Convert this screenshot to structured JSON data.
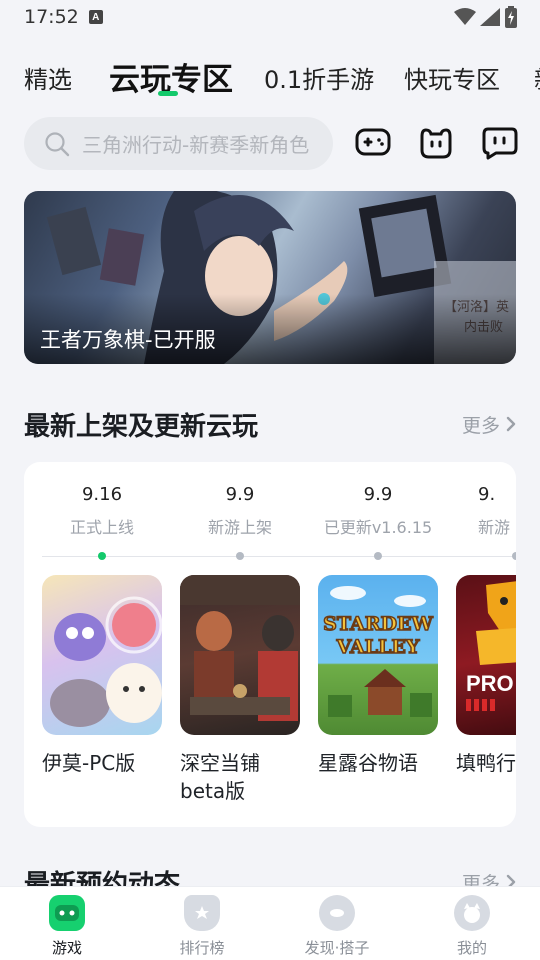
{
  "status_bar": {
    "time": "17:52",
    "notification_badge": "A"
  },
  "tabs": [
    {
      "label": "精选",
      "active": false
    },
    {
      "label": "云玩专区",
      "active": true
    },
    {
      "label": "0.1折手游",
      "active": false
    },
    {
      "label": "快玩专区",
      "active": false
    },
    {
      "label": "新",
      "active": false
    }
  ],
  "search": {
    "placeholder": "三角洲行动-新赛季新角色"
  },
  "header_icons": [
    "gamepad-icon",
    "puppy-icon",
    "chat-bot-icon"
  ],
  "banner": {
    "title": "王者万象棋-已开服",
    "overlay_text": "【河洛】英\n内击败"
  },
  "section1": {
    "title": "最新上架及更新云玩",
    "more": "更多"
  },
  "timeline": [
    {
      "date": "9.16",
      "label": "正式上线"
    },
    {
      "date": "9.9",
      "label": "新游上架"
    },
    {
      "date": "9.9",
      "label": "已更新v1.6.15"
    },
    {
      "date": "9.",
      "label": "新游"
    }
  ],
  "games": [
    {
      "name": "伊莫-PC版"
    },
    {
      "name": "深空当铺beta版"
    },
    {
      "name": "星露谷物语",
      "cover_text": "STARDEW VALLEY"
    },
    {
      "name": "填鸭行",
      "cover_text": "PRO"
    }
  ],
  "section2": {
    "title": "最新预约动态",
    "more": "更多"
  },
  "bottom_nav": [
    {
      "label": "游戏",
      "active": true
    },
    {
      "label": "排行榜",
      "active": false
    },
    {
      "label": "发现·搭子",
      "active": false
    },
    {
      "label": "我的",
      "active": false
    }
  ],
  "colors": {
    "accent": "#13c96b",
    "background": "#f3f4f8"
  }
}
